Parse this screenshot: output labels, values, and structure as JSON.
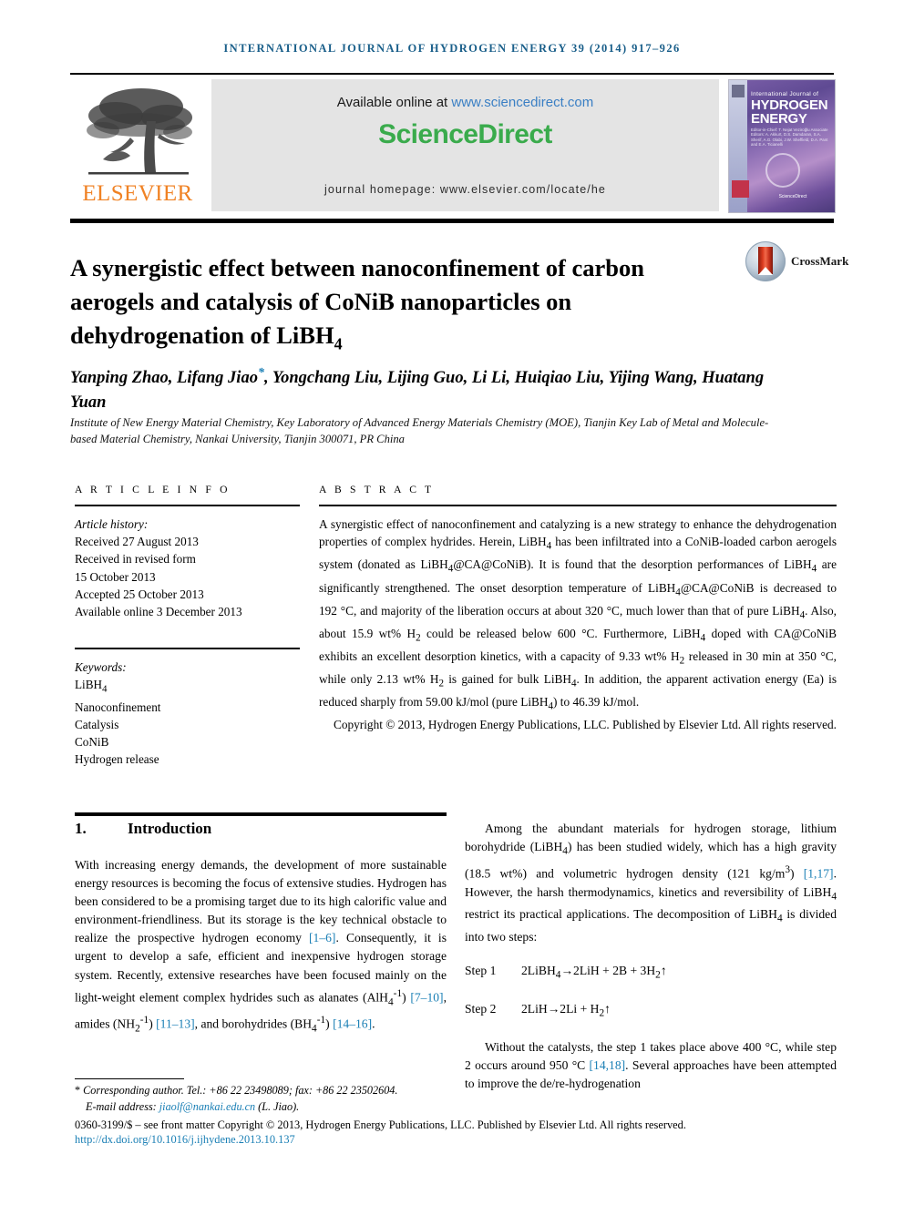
{
  "running_head": "INTERNATIONAL JOURNAL OF HYDROGEN ENERGY 39 (2014) 917–926",
  "banner": {
    "publisher_name": "ELSEVIER",
    "available_prefix": "Available online at ",
    "available_url": "www.sciencedirect.com",
    "sciencedirect_logo": "ScienceDirect",
    "journal_homepage": "journal homepage: www.elsevier.com/locate/he",
    "cover": {
      "line1": "International Journal of",
      "line2": "HYDROGEN ENERGY",
      "editors": "Editor-in-Chief: T. Nejat Veziroğlu   Associate Editors: A. Akkurt, D.S. Damdaran, S.A. Sherif, A.G. Olabi, J.W. Sheffield, D.A. Pant and E.A. Ticianelli",
      "sciencedirect": "ScienceDirect"
    }
  },
  "article": {
    "title": "A synergistic effect between nanoconfinement of carbon aerogels and catalysis of CoNiB nanoparticles on dehydrogenation of LiBH",
    "title_sub": "4",
    "crossmark_label": "CrossMark",
    "authors": "Yanping Zhao, Lifang Jiao",
    "authors_star": "*",
    "authors_rest": ", Yongchang Liu, Lijing Guo, Li Li, Huiqiao Liu, Yijing Wang, Huatang Yuan",
    "affiliation": "Institute of New Energy Material Chemistry, Key Laboratory of Advanced Energy Materials Chemistry (MOE), Tianjin Key Lab of Metal and Molecule-based Material Chemistry, Nankai University, Tianjin 300071, PR China"
  },
  "article_info": {
    "heading": "A R T I C L E   I N F O",
    "history_label": "Article history:",
    "history": [
      "Received 27 August 2013",
      "Received in revised form",
      "15 October 2013",
      "Accepted 25 October 2013",
      "Available online 3 December 2013"
    ],
    "keywords_label": "Keywords:",
    "keywords": [
      "LiBH4",
      "Nanoconfinement",
      "Catalysis",
      "CoNiB",
      "Hydrogen release"
    ]
  },
  "abstract": {
    "heading": "A B S T R A C T",
    "body": "A synergistic effect of nanoconfinement and catalyzing is a new strategy to enhance the dehydrogenation properties of complex hydrides. Herein, LiBH4 has been infiltrated into a CoNiB-loaded carbon aerogels system (donated as LiBH4@CA@CoNiB). It is found that the desorption performances of LiBH4 are significantly strengthened. The onset desorption temperature of LiBH4@CA@CoNiB is decreased to 192 °C, and majority of the liberation occurs at about 320 °C, much lower than that of pure LiBH4. Also, about 15.9 wt% H2 could be released below 600 °C. Furthermore, LiBH4 doped with CA@CoNiB exhibits an excellent desorption kinetics, with a capacity of 9.33 wt% H2 released in 30 min at 350 °C, while only 2.13 wt% H2 is gained for bulk LiBH4. In addition, the apparent activation energy (Ea) is reduced sharply from 59.00 kJ/mol (pure LiBH4) to 46.39 kJ/mol.",
    "copyright": "Copyright © 2013, Hydrogen Energy Publications, LLC. Published by Elsevier Ltd. All rights reserved."
  },
  "introduction": {
    "number": "1.",
    "heading": "Introduction",
    "left_paragraph": "With increasing energy demands, the development of more sustainable energy resources is becoming the focus of extensive studies. Hydrogen has been considered to be a promising target due to its high calorific value and environment-friendliness. But its storage is the key technical obstacle to realize the prospective hydrogen economy [1–6]. Consequently, it is urgent to develop a safe, efficient and inexpensive hydrogen storage system. Recently, extensive researches have been focused mainly on the light-weight element complex hydrides such as alanates (AlH4-1) [7–10], amides (NH2-1) [11–13], and borohydrides (BH4-1) [14–16].",
    "right_paragraph_1": "Among the abundant materials for hydrogen storage, lithium borohydride (LiBH4) has been studied widely, which has a high gravity (18.5 wt%) and volumetric hydrogen density (121 kg/m3) [1,17]. However, the harsh thermodynamics, kinetics and reversibility of LiBH4 restrict its practical applications. The decomposition of LiBH4 is divided into two steps:",
    "step1_label": "Step 1",
    "step1_eq": "2LiBH4→2LiH + 2B + 3H2↑",
    "step2_label": "Step 2",
    "step2_eq": "2LiH→2Li + H2↑",
    "right_paragraph_2": "Without the catalysts, the step 1 takes place above 400 °C, while step 2 occurs around 950 °C [14,18]. Several approaches have been attempted to improve the de/re-hydrogenation"
  },
  "footer": {
    "corresponding_star": "*",
    "corresponding": " Corresponding author. Tel.: +86 22 23498089; fax: +86 22 23502604.",
    "email_label": "E-mail address: ",
    "email": "jiaolf@nankai.edu.cn",
    "email_suffix": " (L. Jiao).",
    "frontmatter": "0360-3199/$ – see front matter Copyright © 2013, Hydrogen Energy Publications, LLC. Published by Elsevier Ltd. All rights reserved.",
    "doi": "http://dx.doi.org/10.1016/j.ijhydene.2013.10.137"
  },
  "colors": {
    "accent_link": "#1a7fb5",
    "sciencedirect_green": "#3aab4c",
    "elsevier_orange": "#f08224",
    "running_head_blue": "#1a5f8a"
  }
}
